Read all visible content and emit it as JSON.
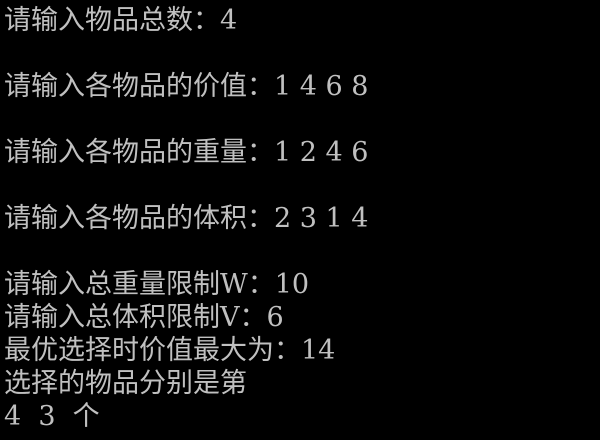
{
  "terminal": {
    "lines": [
      "请输入物品总数：4",
      "",
      "请输入各物品的价值：1 4 6 8",
      "",
      "请输入各物品的重量：1 2 4 6",
      "",
      "请输入各物品的体积：2 3 1 4",
      "",
      "请输入总重量限制W：10",
      "请输入总体积限制V：6",
      "最优选择时价值最大为：14",
      "选择的物品分别是第",
      "4  3  个"
    ],
    "text_color": "#c0c0c0",
    "background_color": "#000000"
  }
}
